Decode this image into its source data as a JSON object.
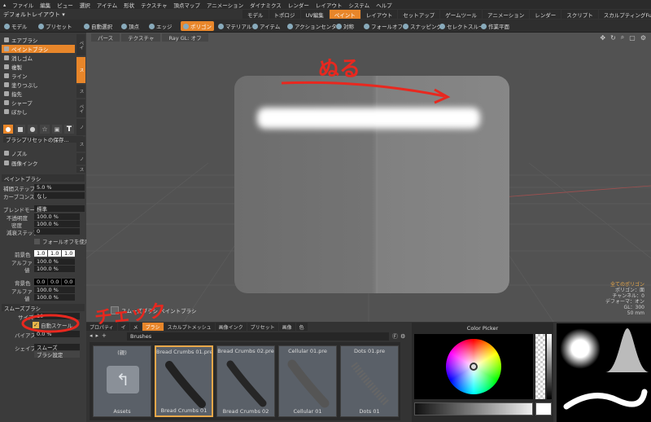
{
  "menu": [
    "ファイル",
    "編集",
    "ビュー",
    "選択",
    "アイテム",
    "形状",
    "テクスチャ",
    "頂点マップ",
    "アニメーション",
    "ダイナミクス",
    "レンダー",
    "レイアウト",
    "システム",
    "ヘルプ"
  ],
  "layout": {
    "name": "デフォルトレイアウト ▾",
    "tabs": [
      {
        "label": "モデル"
      },
      {
        "label": "トポロジ"
      },
      {
        "label": "UV編集"
      },
      {
        "label": "ペイント",
        "active": true
      },
      {
        "label": "レイアウト"
      },
      {
        "label": "セットアップ"
      },
      {
        "label": "ゲームツール"
      },
      {
        "label": "アニメーション"
      },
      {
        "label": "レンダー"
      },
      {
        "label": "スクリプト"
      },
      {
        "label": "スカルプティングFusion"
      }
    ],
    "add": "+"
  },
  "toolbar": {
    "model": "モデル",
    "preset": "プリセット",
    "auto_select": "自動選択",
    "vertex": "頂点",
    "edge": "エッジ",
    "polygon": "ポリゴン",
    "material": "マテリアル",
    "item": "アイテム",
    "action_center": "アクションセンター",
    "symmetry": "対称",
    "falloff": "フォールオフ",
    "snapping": "スナッピング",
    "select_through": "セレクトスルー",
    "work_plane": "作業平面"
  },
  "tools": [
    "エアブラシ",
    "ペイントブラシ",
    "消しゴム",
    "複製",
    "ライン",
    "塗りつぶし",
    "指先",
    "シャープ",
    "ぼかし"
  ],
  "vtabs": [
    "ペイ",
    "ス",
    "ス",
    "ペイ",
    "ノ",
    "ス",
    "ノ",
    "ス"
  ],
  "brush_preset": "ブラシプリセットの保存...",
  "nozzle": "ノズル",
  "image_ink": "画像インク",
  "paint_brush": {
    "header": "ペイントブラシ",
    "interp_step_label": "補間ステップ",
    "interp_step": "5.0 %",
    "curve_label": "カーブコンス...",
    "curve": "なし",
    "blend_label": "ブレンドモード",
    "blend": "標準",
    "opacity_label": "不透明度",
    "opacity": "100.0 %",
    "density_label": "密度",
    "density": "100.0 %",
    "decay_label": "減衰ステップ",
    "decay": "0",
    "falloff_label": "フォールオフを使用"
  },
  "fg": {
    "label": "前景色",
    "r": "1.0",
    "g": "1.0",
    "b": "1.0",
    "alpha_label": "アルファ",
    "alpha": "100.0 %",
    "value_label": "値",
    "value": "100.0 %"
  },
  "bg": {
    "label": "背景色",
    "r": "0.0",
    "g": "0.0",
    "b": "0.0",
    "alpha_label": "アルファ",
    "alpha": "100.0 %",
    "value_label": "値",
    "value": "100.0 %"
  },
  "smooth": {
    "header": "スムーズブラシ",
    "size_label": "サイズ",
    "size": "10",
    "auto_scale": "自動スケール",
    "bias_label": "バイアス",
    "bias": "0.0 %",
    "shape_label": "シェイプ",
    "shape": "スムーズ",
    "brush_settings": "ブラシ設定"
  },
  "viewport": {
    "tabs": [
      "パース",
      "テクスチャ",
      "Ray GL: オフ"
    ],
    "info": [
      "全てのポリゴン",
      "ポリゴン：面",
      "チャンネル：0",
      "デフォーマ：オン",
      "GL：300",
      "50 mm"
    ],
    "overlay": "スムーズブラシ ペイントブラシ"
  },
  "annotations": {
    "nuru": "ぬる",
    "check": "チェック"
  },
  "brushes": {
    "tabs": [
      "プロパティ",
      "イ",
      "メ",
      "ブラシ",
      "スカルプトメッシュ",
      "画像インク",
      "プリセット",
      "画像",
      "色"
    ],
    "active_tab": "ブラシ",
    "path": "Brushes",
    "items": [
      {
        "name": "(親)",
        "caption": "Assets"
      },
      {
        "name": "Bread Crumbs 01.pre",
        "caption": "Bread Crumbs 01"
      },
      {
        "name": "Bread Crumbs 02.pre",
        "caption": "Bread Crumbs 02"
      },
      {
        "name": "Cellular 01.pre",
        "caption": "Cellular 01"
      },
      {
        "name": "Dots 01.pre",
        "caption": "Dots 01"
      }
    ]
  },
  "color_picker": {
    "title": "Color Picker"
  },
  "colors": {
    "accent": "#e8862a",
    "annotation": "#e8281f"
  }
}
